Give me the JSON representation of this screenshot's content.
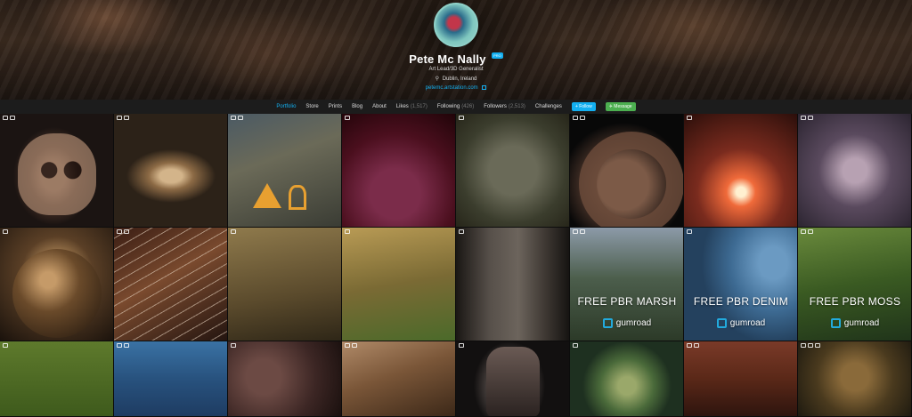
{
  "profile": {
    "name": "Pete Mc Nally",
    "badge": "PRO",
    "headline": "Art Lead/3D Generalist",
    "location": "Dublin, Ireland",
    "website": "petemc.artstation.com"
  },
  "nav": {
    "items": [
      {
        "label": "Portfolio",
        "count": ""
      },
      {
        "label": "Store",
        "count": ""
      },
      {
        "label": "Prints",
        "count": ""
      },
      {
        "label": "Blog",
        "count": ""
      },
      {
        "label": "About",
        "count": ""
      },
      {
        "label": "Likes",
        "count": "(1,517)"
      },
      {
        "label": "Following",
        "count": "(426)"
      },
      {
        "label": "Followers",
        "count": "(2,513)"
      },
      {
        "label": "Challenges",
        "count": ""
      }
    ],
    "follow_label": "Follow",
    "message_label": "Message",
    "active": "Portfolio"
  },
  "tiles": {
    "t14": {
      "title": "FREE PBR MARSH",
      "brand": "gumroad"
    },
    "t15": {
      "title": "FREE PBR DENIM",
      "brand": "gumroad"
    },
    "t16": {
      "title": "FREE PBR MOSS",
      "brand": "gumroad"
    }
  },
  "colors": {
    "accent": "#13aff0",
    "message": "#4caf50",
    "navbar_bg": "#1c1c1c"
  }
}
